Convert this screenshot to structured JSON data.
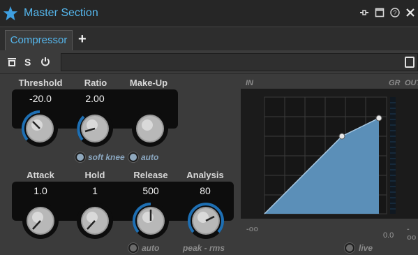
{
  "window": {
    "title": "Master Section"
  },
  "tabs": {
    "active": "Compressor",
    "add_label": "+"
  },
  "toolbar": {
    "bypass_label": "ᾱ",
    "solo_label": "S",
    "power_label": "⏻",
    "preset_value": ""
  },
  "compressor": {
    "threshold": {
      "label": "Threshold",
      "value": "-20.0"
    },
    "ratio": {
      "label": "Ratio",
      "value": "2.00"
    },
    "makeup": {
      "label": "Make-Up",
      "value": ""
    },
    "soft_knee_label": "soft knee",
    "makeup_auto_label": "auto",
    "attack": {
      "label": "Attack",
      "value": "1.0"
    },
    "hold": {
      "label": "Hold",
      "value": "1"
    },
    "release": {
      "label": "Release",
      "value": "500"
    },
    "analysis": {
      "label": "Analysis",
      "value": "80"
    },
    "release_auto_label": "auto",
    "analysis_mode_label": "peak - rms"
  },
  "graph": {
    "in_label": "IN",
    "gr_label": "GR",
    "out_label": "OUT",
    "left_scale": "-oo",
    "zero_label": "0.0",
    "right_scale": "-oo",
    "live_label": "live"
  },
  "colors": {
    "accent": "#55b6ec",
    "curve_fill": "#5b8fb8",
    "knob_ring": "#1e6fb3"
  },
  "icons": [
    "star-icon",
    "pin-icon",
    "maximize-icon",
    "help-icon",
    "close-icon",
    "preset-menu-icon"
  ]
}
